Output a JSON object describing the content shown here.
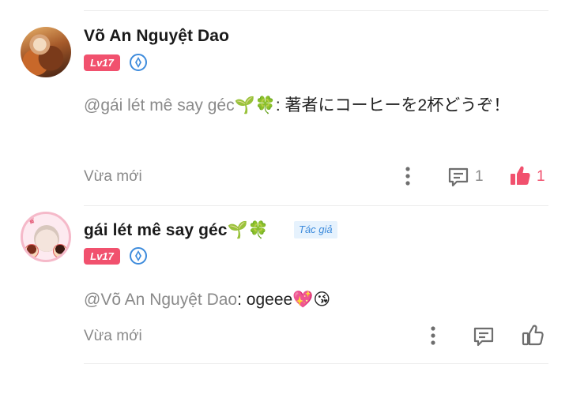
{
  "comments": [
    {
      "user": "Võ An Nguyệt Dao",
      "level": "Lv17",
      "mention": "@gái lét mê say géc🌱🍀",
      "text": ": 著者にコーヒーを2杯どうぞ！",
      "time": "Vừa mới",
      "reply_count": "1",
      "like_count": "1",
      "liked": true
    },
    {
      "user": "gái lét mê say géc🌱🍀",
      "author_tag": "Tác giả",
      "level": "Lv17",
      "mention": "@Võ An Nguyệt Dao",
      "text": ": ogeee💖😘",
      "time": "Vừa mới",
      "liked": false
    }
  ],
  "icons": {
    "more": "more-vertical-icon",
    "reply": "comment-icon",
    "like": "thumbs-up-icon",
    "badge": "verified-badge-icon"
  },
  "colors": {
    "level_badge": "#f1516e",
    "liked": "#f1516e",
    "author_tag_bg": "#e6f2fd",
    "author_tag_text": "#3d8bdc",
    "muted": "#8a8a8a"
  }
}
